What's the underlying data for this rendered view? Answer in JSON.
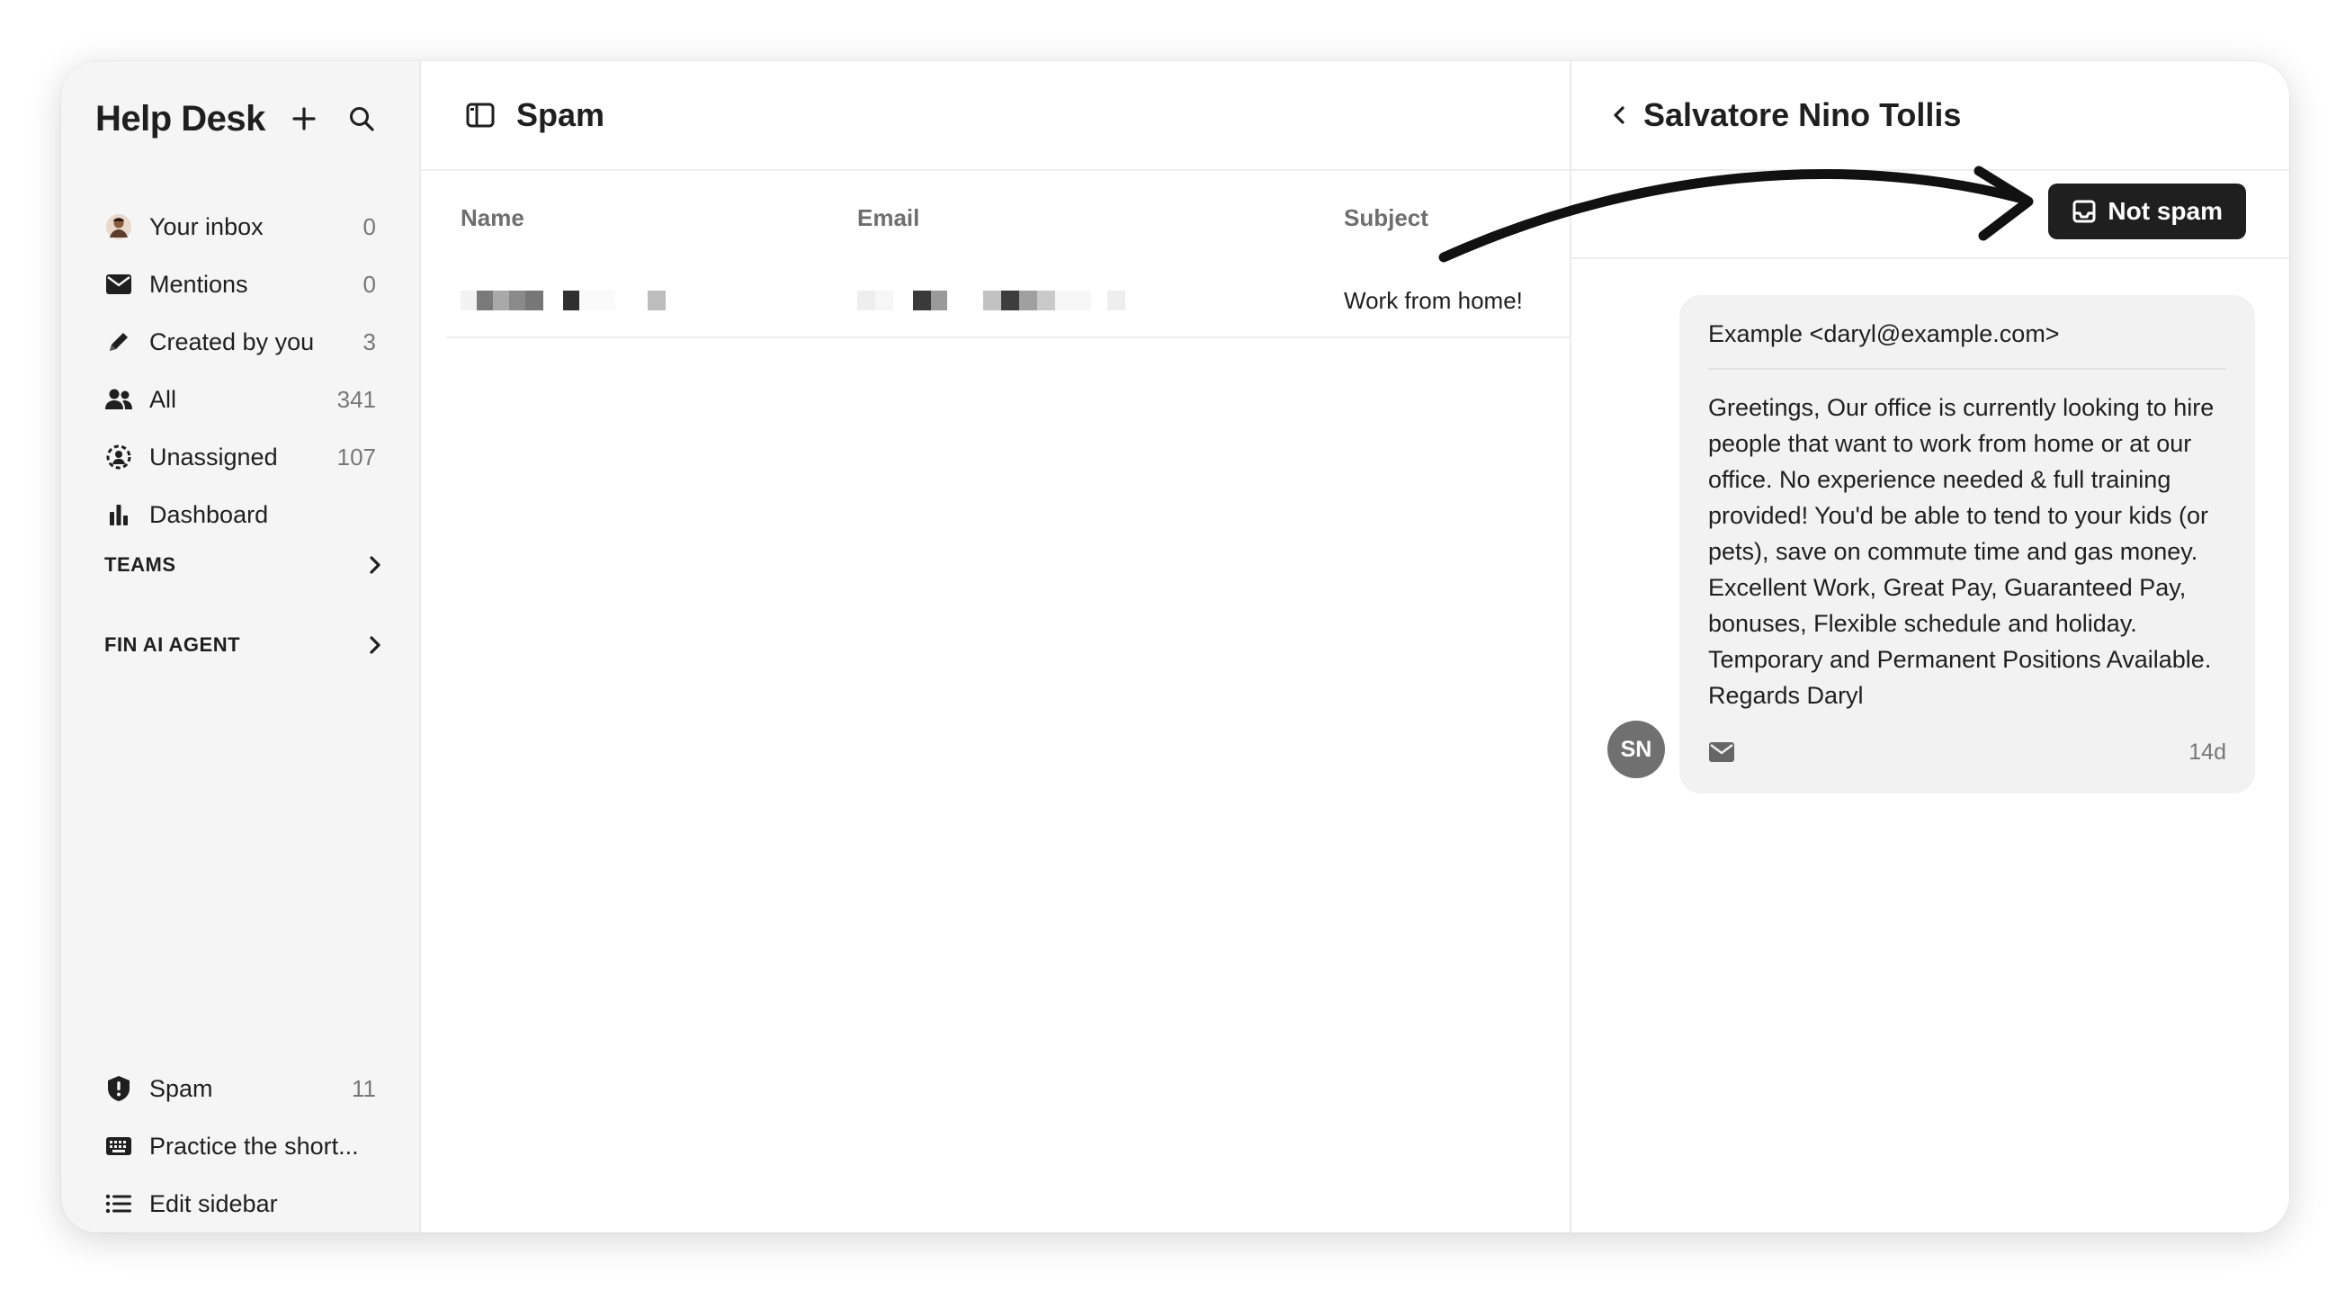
{
  "sidebar": {
    "title": "Help Desk",
    "items": [
      {
        "label": "Your inbox",
        "count": "0"
      },
      {
        "label": "Mentions",
        "count": "0"
      },
      {
        "label": "Created by you",
        "count": "3"
      },
      {
        "label": "All",
        "count": "341"
      },
      {
        "label": "Unassigned",
        "count": "107"
      },
      {
        "label": "Dashboard",
        "count": ""
      }
    ],
    "sections": [
      {
        "label": "TEAMS"
      },
      {
        "label": "FIN AI AGENT"
      }
    ],
    "bottom_items": [
      {
        "label": "Spam",
        "count": "11"
      },
      {
        "label": "Practice the short...",
        "count": ""
      },
      {
        "label": "Edit sidebar",
        "count": ""
      }
    ]
  },
  "list": {
    "title": "Spam",
    "columns": {
      "name": "Name",
      "email": "Email",
      "subject": "Subject"
    },
    "rows": [
      {
        "subject": "Work from home!"
      }
    ]
  },
  "detail": {
    "title": "Salvatore Nino Tollis",
    "not_spam_label": "Not spam",
    "message": {
      "from": "Example <daryl@example.com>",
      "body": "Greetings, Our office is currently looking to hire people that want to work from home or at our office. No experience needed & full training provided! You'd be able to tend to your kids (or pets), save on commute time and gas money. Excellent Work, Great Pay, Guaranteed Pay, bonuses, Flexible schedule and holiday. Temporary and Permanent Positions Available. Regards Daryl",
      "time": "14d",
      "avatar_initials": "SN"
    }
  },
  "colors": {
    "accent": "#1f1f1f",
    "sidebar_bg": "#f5f5f5",
    "bubble_bg": "#f2f2f2",
    "avatar_bg": "#707070"
  }
}
